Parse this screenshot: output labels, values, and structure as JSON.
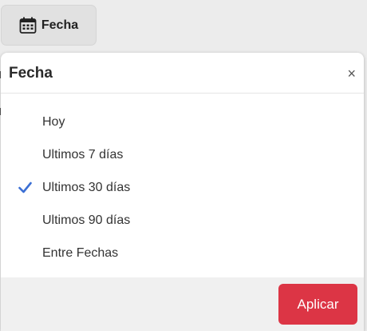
{
  "trigger": {
    "label": "Fecha",
    "icon": "calendar-icon"
  },
  "popover": {
    "title": "Fecha",
    "close_label": "×",
    "options": [
      {
        "label": "Hoy",
        "selected": false
      },
      {
        "label": "Ultimos 7 días",
        "selected": false
      },
      {
        "label": "Ultimos 30 días",
        "selected": true
      },
      {
        "label": "Ultimos 90 días",
        "selected": false
      },
      {
        "label": "Entre Fechas",
        "selected": false
      }
    ],
    "apply_label": "Aplicar"
  },
  "colors": {
    "accent_check": "#3b6fd4",
    "apply_button": "#dc3545"
  }
}
